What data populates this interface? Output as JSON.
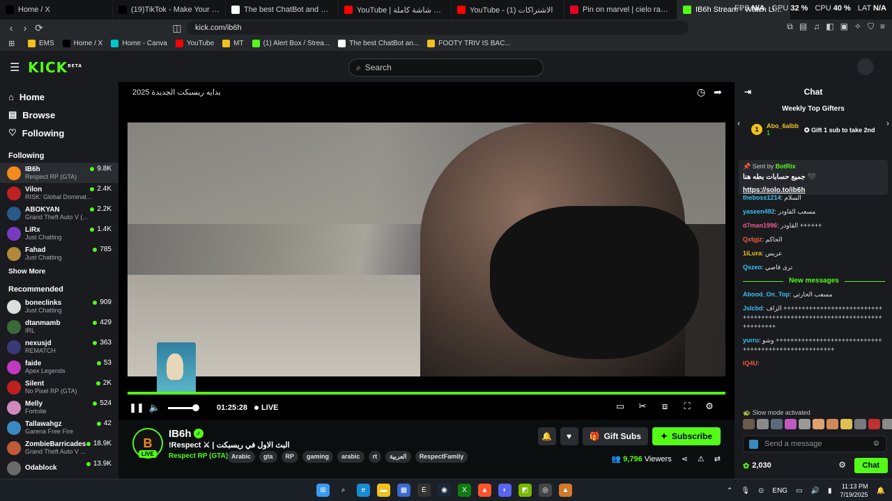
{
  "browser": {
    "tabs": [
      {
        "title": "Home / X",
        "icon": "x-icon",
        "color": "#000000"
      },
      {
        "title": "(19)TikTok - Make Your Day",
        "icon": "tiktok-icon",
        "color": "#000000"
      },
      {
        "title": "The best ChatBot and Widgets for Ki",
        "icon": "diamond-icon",
        "color": "#ffffff"
      },
      {
        "title": "YouTube | البث مجاني شاشة كاملة",
        "icon": "youtube-icon",
        "color": "#ff0000"
      },
      {
        "title": "YouTube - الاشتراكات (1)",
        "icon": "youtube-icon",
        "color": "#ff0000"
      },
      {
        "title": "Pin on marvel | cielo razumovsky",
        "icon": "pinterest-icon",
        "color": "#e60023"
      },
      {
        "title": "IB6h Stream - Watch Live on",
        "icon": "kick-icon",
        "color": "#53fc18",
        "active": true
      }
    ],
    "stats": {
      "fps_label": "FPS",
      "fps": "N/A",
      "gpu_label": "GPU",
      "gpu": "32 %",
      "cpu_label": "CPU",
      "cpu": "40 %",
      "lat_label": "LAT",
      "lat": "N/A"
    },
    "url": "kick.com/ib6h",
    "bookmarks": [
      {
        "label": "EMS",
        "color": "#f2c21c"
      },
      {
        "label": "Home / X",
        "color": "#000000"
      },
      {
        "label": "Home - Canva",
        "color": "#00c4cc"
      },
      {
        "label": "YouTube",
        "color": "#ff0000"
      },
      {
        "label": "MT",
        "color": "#f2c21c"
      },
      {
        "label": "(1) Alert Box / Strea...",
        "color": "#53fc18"
      },
      {
        "label": "The best ChatBot an...",
        "color": "#ffffff"
      },
      {
        "label": "FOOTY TRIV IS BAC...",
        "color": "#f2c21c"
      }
    ]
  },
  "header": {
    "logo": "KICK",
    "logo_sup": "BETA",
    "search_placeholder": "Search"
  },
  "sidebar": {
    "nav": [
      {
        "label": "Home",
        "icon": "home-icon"
      },
      {
        "label": "Browse",
        "icon": "browse-icon"
      },
      {
        "label": "Following",
        "icon": "heart-icon"
      }
    ],
    "following_title": "Following",
    "following": [
      {
        "name": "IB6h",
        "category": "Respect RP (GTA)",
        "viewers": "9.8K",
        "color": "#f28a1c",
        "selected": true
      },
      {
        "name": "Vilon",
        "category": "RISK: Global Dominat...",
        "viewers": "2.4K",
        "color": "#c02020"
      },
      {
        "name": "ABOKYAN",
        "category": "Grand Theft Auto V (...",
        "viewers": "2.2K",
        "color": "#2a5a8a"
      },
      {
        "name": "LiRx",
        "category": "Just Chatting",
        "viewers": "1.4K",
        "color": "#7a3ac0"
      },
      {
        "name": "Fahad",
        "category": "Just Chatting",
        "viewers": "785",
        "color": "#b08a3a"
      }
    ],
    "show_more": "Show More",
    "recommended_title": "Recommended",
    "recommended": [
      {
        "name": "boneclinks",
        "category": "Just Chatting",
        "viewers": "909",
        "color": "#dddddd"
      },
      {
        "name": "dtanmamb",
        "category": "IRL",
        "viewers": "429",
        "color": "#3a6a3a"
      },
      {
        "name": "nexusjd",
        "category": "REMATCH",
        "viewers": "363",
        "color": "#3a3a7a"
      },
      {
        "name": "faide",
        "category": "Apex Legends",
        "viewers": "53",
        "color": "#c03ac0"
      },
      {
        "name": "Silent",
        "category": "No Pixel RP (GTA)",
        "viewers": "2K",
        "color": "#c02020"
      },
      {
        "name": "Melly",
        "category": "Fortnite",
        "viewers": "524",
        "color": "#d08ac0"
      },
      {
        "name": "Tallawahgz",
        "category": "Garena Free Fire",
        "viewers": "42",
        "color": "#3a8ac0"
      },
      {
        "name": "ZombieBarricades",
        "category": "Grand Theft Auto V ...",
        "viewers": "18.9K",
        "color": "#c05a3a"
      },
      {
        "name": "Odablock",
        "category": "",
        "viewers": "13.9K",
        "color": "#6a6a6a"
      }
    ]
  },
  "player": {
    "overlay_title": "2025 بدايه ريسبكت الجديدة",
    "time": "01:25:28",
    "live": "LIVE",
    "progress": 1.0
  },
  "channel": {
    "name": "IB6h",
    "avatar_letter": "B",
    "live_badge": "LIVE",
    "stream_title": "!Respect ⚔ | البث الاول في ريسبكت",
    "category": "Respect RP (GTA)",
    "tags": [
      "Arabic",
      "gta",
      "RP",
      "gaming",
      "arabic",
      "rt",
      "العربية",
      "RespectFamily"
    ],
    "gift_subs": "Gift Subs",
    "subscribe": "Subscribe",
    "viewers": "9,796",
    "viewers_label": "Viewers"
  },
  "chat": {
    "title": "Chat",
    "gifters_title": "Weekly Top Gifters",
    "top_gifter": {
      "rank": "1",
      "name": "Abo_6albb",
      "count": "1"
    },
    "gift_cta": "Gift 1 sub to take 2nd",
    "pinned": {
      "sent_by": "Sent by",
      "sender": "BotRix",
      "message": "جميع حسابات بطه هنا 🖤",
      "link": "https://solo.to/ib6h"
    },
    "messages_before": [
      {
        "user": "theboss1214",
        "color": "#3ac0f0",
        "text": "السلام"
      },
      {
        "user": "yaseen492",
        "color": "#3ac0f0",
        "text": "مسعب القاودر"
      },
      {
        "user": "d7man1996",
        "color": "#f05a8a",
        "text": "القاودر ++++++"
      },
      {
        "user": "Qxtgjz",
        "color": "#f05a3a",
        "text": "الحاكم"
      },
      {
        "user": "1iLura",
        "color": "#f2c21c",
        "text": "عريس"
      },
      {
        "user": "Qszeo",
        "color": "#3ac0f0",
        "text": "ترى قاصي"
      }
    ],
    "new_messages": "New messages",
    "messages_after": [
      {
        "user": "Abood_On_Top",
        "color": "#3ac0f0",
        "text": "مسعب الحارثي"
      },
      {
        "user": "Jslcbd",
        "color": "#3ac0f0",
        "text": "الزاف ++++++++++++++++++++++++++++++++++++++++++++++++++++++++++++++++++++++++++"
      },
      {
        "user": "yurru",
        "color": "#3ac0f0",
        "text": "وشو ++++++++++++++++++++++++++++++++++++++++++++++++++++++"
      },
      {
        "user": "IQ4U",
        "color": "#f05a3a",
        "text": ""
      }
    ],
    "slow_mode": "Slow mode activated",
    "input_placeholder": "Send a message",
    "points": "2,030",
    "chat_button": "Chat"
  },
  "taskbar": {
    "lang": "ENG",
    "time": "11:13 PM",
    "date": "7/19/2025"
  }
}
